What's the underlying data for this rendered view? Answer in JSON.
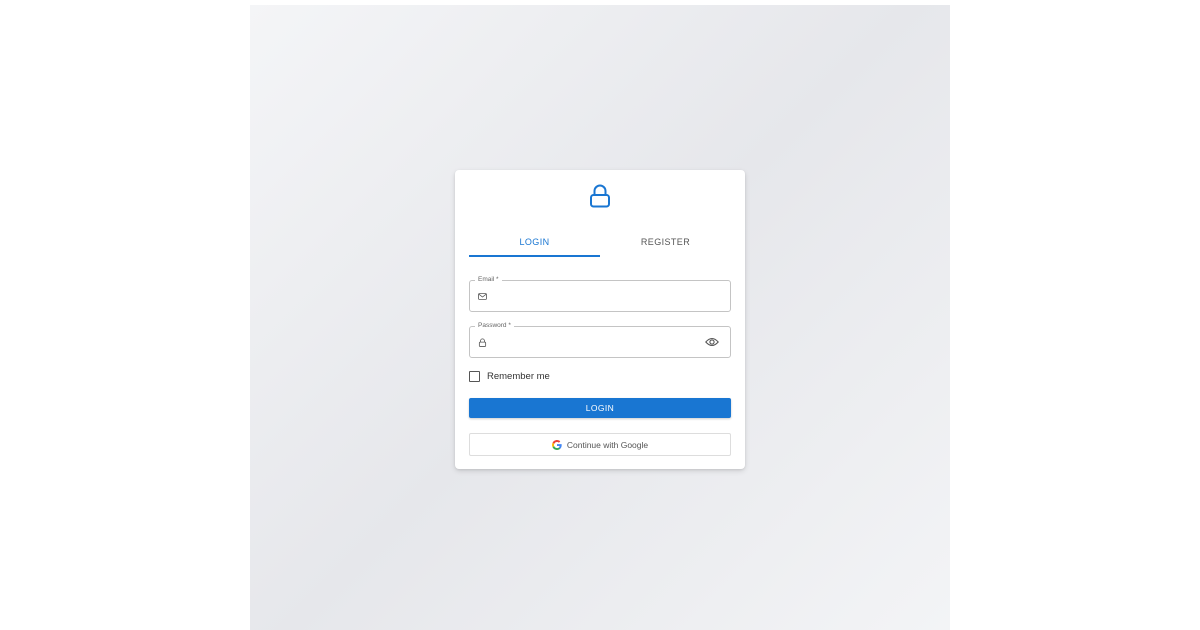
{
  "auth": {
    "logo_icon": "lock-icon",
    "tabs": [
      {
        "label": "LOGIN",
        "active": true
      },
      {
        "label": "REGISTER",
        "active": false
      }
    ],
    "email": {
      "label": "Email *",
      "value": "",
      "icon": "mail-icon"
    },
    "password": {
      "label": "Password *",
      "value": "",
      "icon": "lock-icon",
      "toggle_icon": "eye-icon"
    },
    "remember_me": {
      "label": "Remember me",
      "checked": false
    },
    "login_button": "LOGIN",
    "google_button": "Continue with Google"
  },
  "colors": {
    "primary": "#1976d2",
    "border": "#c4c4c4",
    "text": "#333333"
  }
}
